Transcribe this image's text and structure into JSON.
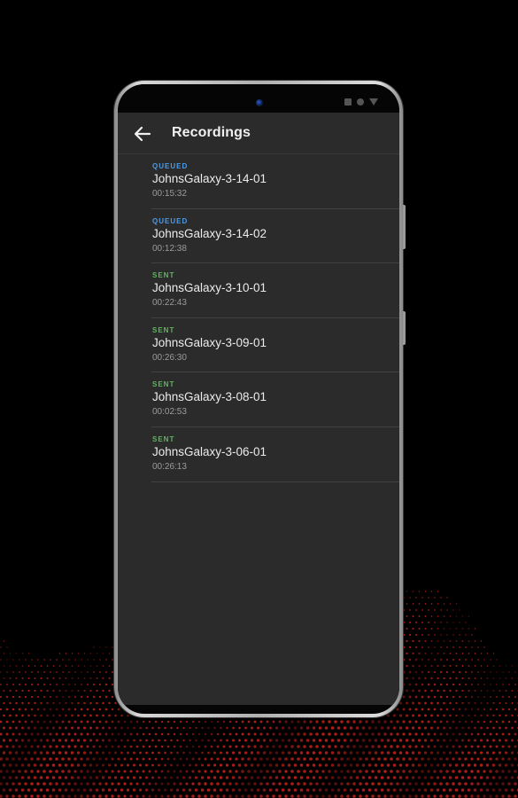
{
  "colors": {
    "background": "#000000",
    "app_background": "#2b2b2b",
    "queued": "#4c9be8",
    "sent": "#5cb85c",
    "dot_wave": "#c0201c"
  },
  "toolbar": {
    "back_icon": "arrow-left-icon",
    "title": "Recordings"
  },
  "recordings": [
    {
      "status": "QUEUED",
      "name": "JohnsGalaxy-3-14-01",
      "duration": "00:15:32"
    },
    {
      "status": "QUEUED",
      "name": "JohnsGalaxy-3-14-02",
      "duration": "00:12:38"
    },
    {
      "status": "SENT",
      "name": "JohnsGalaxy-3-10-01",
      "duration": "00:22:43"
    },
    {
      "status": "SENT",
      "name": "JohnsGalaxy-3-09-01",
      "duration": "00:26:30"
    },
    {
      "status": "SENT",
      "name": "JohnsGalaxy-3-08-01",
      "duration": "00:02:53"
    },
    {
      "status": "SENT",
      "name": "JohnsGalaxy-3-06-01",
      "duration": "00:26:13"
    }
  ]
}
